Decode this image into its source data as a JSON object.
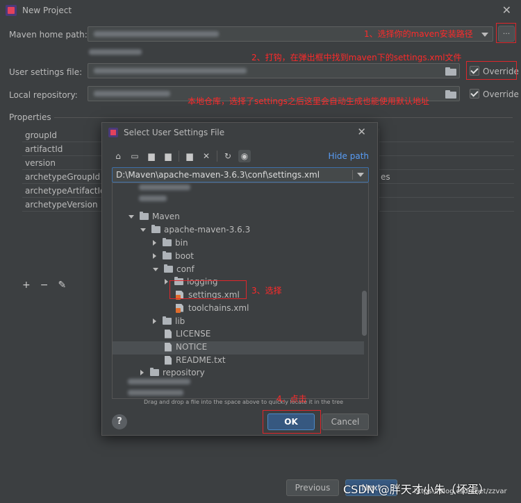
{
  "window": {
    "title": "New Project",
    "close_glyph": "✕"
  },
  "form": {
    "maven_home_label": "Maven home path:",
    "browse_label": "...",
    "user_settings_label": "User settings file:",
    "override_label": "Override",
    "local_repo_label": "Local repository:",
    "override_label_2": "Override",
    "properties_header": "Properties"
  },
  "properties": {
    "names": [
      "groupId",
      "artifactId",
      "version",
      "archetypeGroupId",
      "archetypeArtifactId",
      "archetypeVersion"
    ],
    "right_fragment": "es",
    "toolbar": {
      "add": "+",
      "remove": "−",
      "edit": "✎"
    }
  },
  "annotations": {
    "step1": "1、选择你的maven安装路径",
    "step2": "2、打钩，在弹出框中找到maven下的settings.xml文件",
    "local_note": "本地仓库，选择了settings之后这里会自动生成也能使用默认地址",
    "step3": "3、选择",
    "step4": "4、点击"
  },
  "dialog": {
    "title": "Select User Settings File",
    "close_glyph": "✕",
    "hide_path": "Hide path",
    "path_value": "D:\\Maven\\apache-maven-3.6.3\\conf\\settings.xml",
    "hint": "Drag and drop a file into the space above to quickly locate it in the tree",
    "help": "?",
    "ok": "OK",
    "cancel": "Cancel",
    "tree": {
      "maven": "Maven",
      "apache": "apache-maven-3.6.3",
      "bin": "bin",
      "boot": "boot",
      "conf": "conf",
      "logging": "logging",
      "settings": "settings.xml",
      "toolchains": "toolchains.xml",
      "lib": "lib",
      "license": "LICENSE",
      "notice": "NOTICE",
      "readme": "README.txt",
      "repository": "repository"
    },
    "toolbar_icons": [
      "home-icon",
      "desktop-icon",
      "project-folder-icon",
      "module-folder-icon",
      "new-folder-icon",
      "delete-icon",
      "refresh-icon",
      "show-hidden-icon"
    ]
  },
  "footer": {
    "previous": "Previous",
    "next": "Next",
    "watermark": "CSDN @胖天才小朱（坏蛋）",
    "watermark_url": "https://blog.csdn.net/zzvar"
  },
  "colors": {
    "accent_red": "#e0262b",
    "link_blue": "#589df6",
    "primary_button": "#365880"
  }
}
